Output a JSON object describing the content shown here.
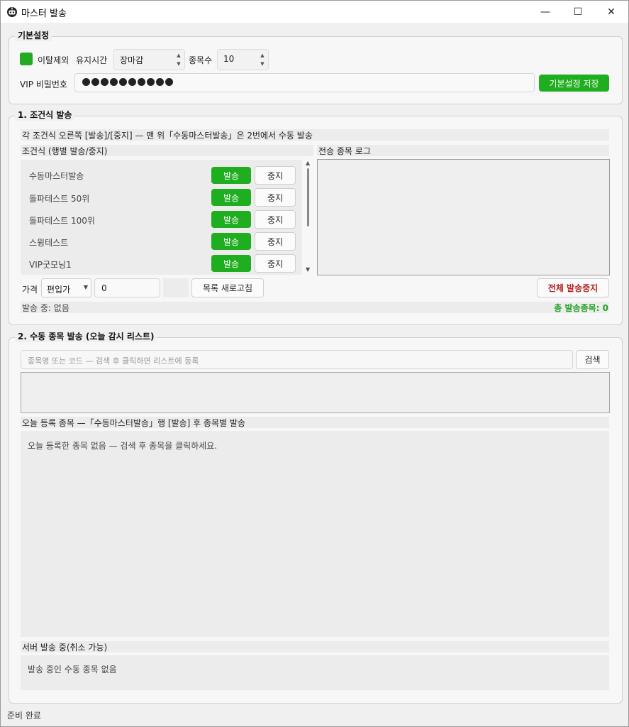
{
  "window": {
    "title": "마스터 발송",
    "controls": {
      "minimize": "—",
      "maximize": "☐",
      "close": "✕"
    }
  },
  "basic": {
    "title": "기본설정",
    "exclude_label": "이탈제외",
    "exclude_checked": true,
    "hold_label": "유지시간",
    "hold_value": "장마감",
    "count_label": "종목수",
    "count_value": "10",
    "vip_label": "VIP 비밀번호",
    "vip_password_dots": 10,
    "save_label": "기본설정 저장"
  },
  "conditions": {
    "title": "1. 조건식 발송",
    "info": "각 조건식 오른쪽 [발송]/[중지] — 맨 위「수동마스터발송」은 2번에서 수동 발송",
    "list_header": "조건식 (행별 발송/중지)",
    "log_header": "전송 종목 로그",
    "send_label": "발송",
    "stop_label": "중지",
    "items": [
      {
        "label": "수동마스터발송"
      },
      {
        "label": "돌파테스트 50위"
      },
      {
        "label": "돌파테스트 100위"
      },
      {
        "label": "스윙테스트"
      },
      {
        "label": "VIP굿모닝1"
      }
    ],
    "price_label": "가격",
    "price_type": "편입가",
    "price_value": "0",
    "refresh_label": "목록 새로고침",
    "stop_all_label": "전체 발송중지",
    "status": "발송 중: 없음",
    "total": "총 발송종목: 0"
  },
  "manual": {
    "title": "2. 수동 종목 발송 (오늘 감시 리스트)",
    "search_placeholder": "종목명 또는 코드 — 검색 후 클릭하면 리스트에 등록",
    "search_label": "검색",
    "today_header": "오늘 등록 종목 —「수동마스터발송」행 [발송] 후 종목별 발송",
    "today_empty": "오늘 등록한 종목 없음 — 검색 후 종목을 클릭하세요.",
    "server_header": "서버 발송 중(취소 가능)",
    "server_empty": "발송 중인 수동 종목 없음"
  },
  "statusbar": {
    "text": "준비 완료"
  },
  "colors": {
    "accent_green": "#1fae1f",
    "danger_red": "#b22222",
    "total_green": "#22a022"
  }
}
